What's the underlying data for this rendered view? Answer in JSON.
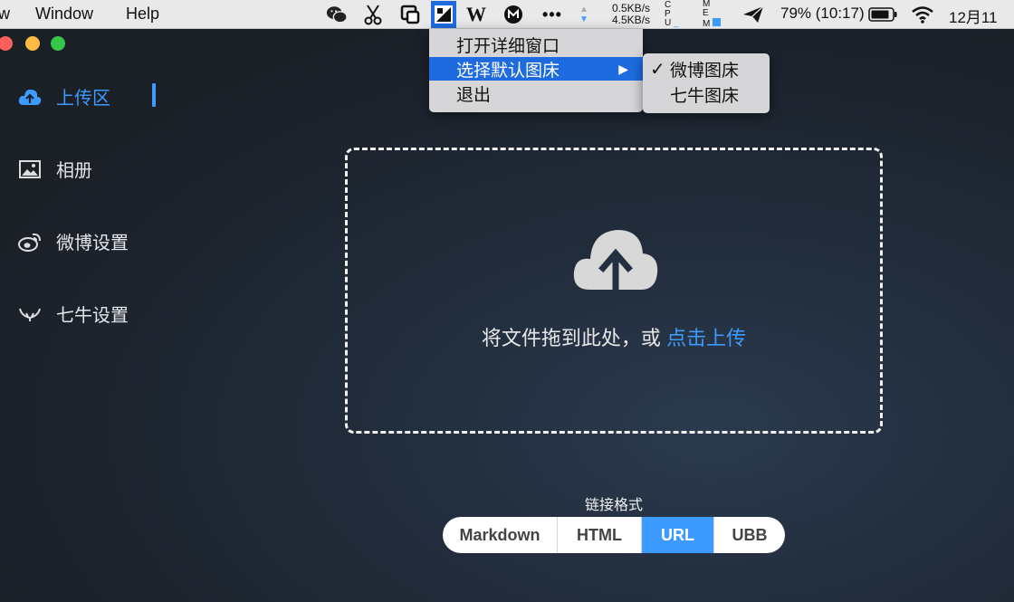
{
  "menubar": {
    "items": [
      "w",
      "Window",
      "Help"
    ],
    "icons": [
      "wechat-icon",
      "scissors-icon",
      "screen-capture-icon",
      "image-upload-app-icon",
      "w-app-icon",
      "m-app-icon",
      "more-icon",
      "network-arrows-icon",
      "cpu-monitor-icon",
      "mem-monitor-icon",
      "paper-plane-icon",
      "battery-icon",
      "wifi-icon"
    ],
    "net_up": "0.5KB/s",
    "net_down": "4.5KB/s",
    "battery": "79% (10:17)",
    "clock": "12月11"
  },
  "sidebar": {
    "items": [
      {
        "label": "上传区",
        "icon": "cloud-upload-icon"
      },
      {
        "label": "相册",
        "icon": "image-icon"
      },
      {
        "label": "微博设置",
        "icon": "weibo-icon"
      },
      {
        "label": "七牛设置",
        "icon": "qiniu-icon"
      }
    ]
  },
  "upload": {
    "text": "将文件拖到此处，或",
    "link": "点击上传",
    "icon": "cloud-upload-icon"
  },
  "format": {
    "title": "链接格式",
    "options": [
      "Markdown",
      "HTML",
      "URL",
      "UBB"
    ],
    "selected": "URL"
  },
  "menu": {
    "items": [
      "打开详细窗口",
      "选择默认图床",
      "退出"
    ],
    "highlighted": "选择默认图床"
  },
  "submenu": {
    "items": [
      "微博图床",
      "七牛图床"
    ],
    "checked": "微博图床",
    "checkmark": "✓"
  },
  "colors": {
    "accent": "#3d9bff",
    "menu_highlight": "#1e6be0",
    "close": "#fc605c",
    "minimize": "#fdbc40",
    "zoom": "#34c84a"
  }
}
